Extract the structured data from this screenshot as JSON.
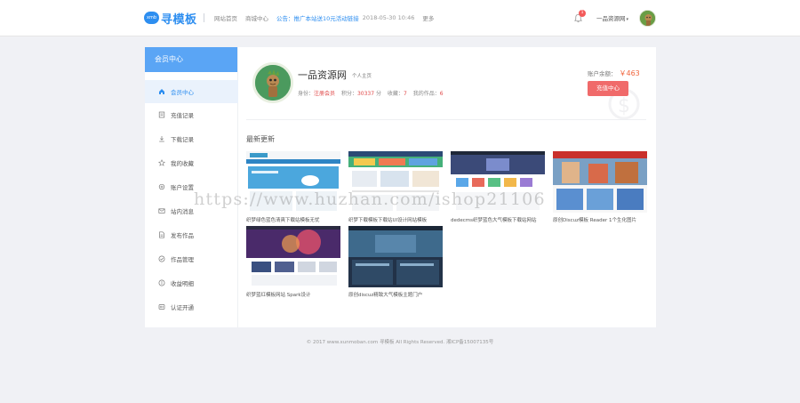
{
  "header": {
    "logo_mark": "xmb",
    "logo_text": "寻模板",
    "nav": [
      "网站首页",
      "商城中心"
    ],
    "notice": "公告：推广本站送10元活动链接",
    "time": "2018-05-30 10:46",
    "more": "更多",
    "bell_count": "1",
    "username": "一品资源网",
    "caret": "▾"
  },
  "sidebar": {
    "title": "会员中心",
    "items": [
      {
        "label": "会员中心",
        "icon": "home-icon"
      },
      {
        "label": "充值记录",
        "icon": "receipt-icon"
      },
      {
        "label": "下载记录",
        "icon": "download-icon"
      },
      {
        "label": "我的收藏",
        "icon": "star-icon"
      },
      {
        "label": "账户设置",
        "icon": "gear-icon"
      },
      {
        "label": "站内消息",
        "icon": "mail-icon"
      },
      {
        "label": "发布作品",
        "icon": "document-icon"
      },
      {
        "label": "作品管理",
        "icon": "check-circle-icon"
      },
      {
        "label": "收益明细",
        "icon": "coin-icon"
      },
      {
        "label": "认证开通",
        "icon": "badge-icon"
      }
    ]
  },
  "profile": {
    "name": "一品资源网",
    "tag": "个人主页",
    "identity_label": "身份：",
    "identity_value": "注册会员",
    "points_label": "积分：",
    "points_value": "30337",
    "points_unit": "分",
    "favorites_label": "收藏：",
    "favorites_value": "7",
    "works_label": "我的作品：",
    "works_value": "6",
    "balance_label": "账户余额：",
    "balance_value": "￥463",
    "recharge_label": "充值中心"
  },
  "latest": {
    "title": "最新更新",
    "items": [
      {
        "caption": "织梦绿色蓝色清爽下载站模板无忧"
      },
      {
        "caption": "织梦下载模板下载站UI设计网站模板"
      },
      {
        "caption": "dedecms织梦蓝色大气模板下载站网站"
      },
      {
        "caption": "原创Discuz模板 Reader 1个生化图片"
      },
      {
        "caption": "织梦蓝红模板网站 Spark设计"
      },
      {
        "caption": "原创discuz精致大气模板主题门户"
      }
    ]
  },
  "footer": {
    "text": "© 2017 www.xunmoban.com 寻模板 All Rights Reserved. 湘ICP备15007135号"
  },
  "watermark": {
    "text": "https://www.huzhan.com/ishop21106"
  },
  "colors": {
    "accent": "#2d8ef0",
    "sidebar_head": "#5aa5f5",
    "recharge": "#f06a6a"
  }
}
